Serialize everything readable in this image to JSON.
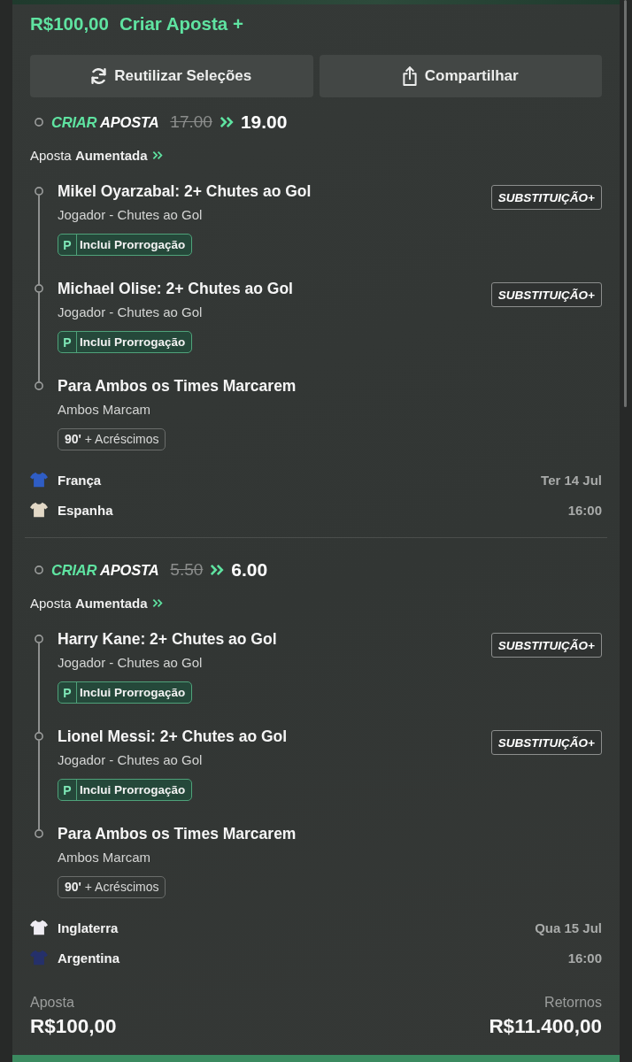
{
  "header": {
    "stake": "R$100,00",
    "title": "Criar Aposta +"
  },
  "actions": [
    {
      "label": "Reutilizar Seleções"
    },
    {
      "label": "Compartilhar"
    }
  ],
  "bets": [
    {
      "brand": {
        "accent": "CRIAR",
        "text": "APOSTA"
      },
      "old_odds": "17.00",
      "odds": "19.00",
      "boost": "Aposta **Aumentada**",
      "selections": [
        {
          "title": "Mikel Oyarzabal: 2+ Chutes ao Gol",
          "market": "Jogador - Chutes ao Gol",
          "tag": {
            "kind": "extra",
            "letter": "P",
            "label": "Inclui Prorrogação"
          },
          "swap": "SUBSTITUIÇÃO+"
        },
        {
          "title": "Michael Olise: 2+ Chutes ao Gol",
          "market": "Jogador - Chutes ao Gol",
          "tag": {
            "kind": "extra",
            "letter": "P",
            "label": "Inclui Prorrogação"
          },
          "swap": "SUBSTITUIÇÃO+"
        },
        {
          "title": "Para Ambos os Times Marcarem",
          "market": "Ambos Marcam",
          "tag": {
            "kind": "regular",
            "label": "**90'** + Acréscimos"
          }
        }
      ],
      "match": {
        "teams": [
          {
            "name": "França",
            "color": "#2f5dc4"
          },
          {
            "name": "Espanha",
            "color": "#e2d8c6"
          }
        ],
        "date": "Ter 14 Jul",
        "time": "16:00"
      }
    },
    {
      "brand": {
        "accent": "CRIAR",
        "text": "APOSTA"
      },
      "old_odds": "5.50",
      "odds": "6.00",
      "boost": "Aposta **Aumentada**",
      "selections": [
        {
          "title": "Harry Kane: 2+ Chutes ao Gol",
          "market": "Jogador - Chutes ao Gol",
          "tag": {
            "kind": "extra",
            "letter": "P",
            "label": "Inclui Prorrogação"
          },
          "swap": "SUBSTITUIÇÃO+"
        },
        {
          "title": "Lionel Messi: 2+ Chutes ao Gol",
          "market": "Jogador - Chutes ao Gol",
          "tag": {
            "kind": "extra",
            "letter": "P",
            "label": "Inclui Prorrogação"
          },
          "swap": "SUBSTITUIÇÃO+"
        },
        {
          "title": "Para Ambos os Times Marcarem",
          "market": "Ambos Marcam",
          "tag": {
            "kind": "regular",
            "label": "**90'** + Acréscimos"
          }
        }
      ],
      "match": {
        "teams": [
          {
            "name": "Inglaterra",
            "color": "#eeecf2"
          },
          {
            "name": "Argentina",
            "color": "#25306a"
          }
        ],
        "date": "Qua 15 Jul",
        "time": "16:00"
      }
    }
  ],
  "footer": {
    "stake_label": "Aposta",
    "stake": "R$100,00",
    "returns_label": "Retornos",
    "returns": "R$11.400,00"
  }
}
